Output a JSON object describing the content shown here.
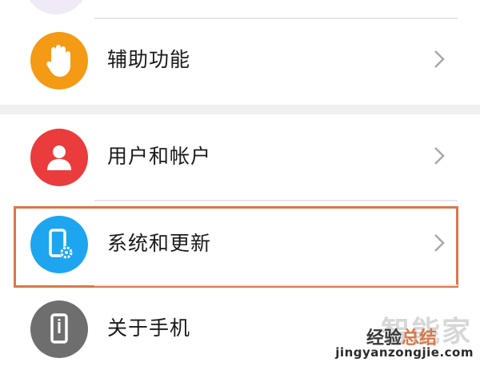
{
  "menu": {
    "items": [
      {
        "label": "辅助功能",
        "icon": "hand-icon",
        "color": "#f59a14"
      },
      {
        "label": "用户和帐户",
        "icon": "user-icon",
        "color": "#ea3c3c"
      },
      {
        "label": "系统和更新",
        "icon": "phone-gear-icon",
        "color": "#1ea5f0"
      },
      {
        "label": "关于手机",
        "icon": "phone-info-icon",
        "color": "#6e6e6e"
      }
    ]
  },
  "highlight_color": "#d9784a",
  "watermark": {
    "logo_text": "智能家",
    "site_name_prefix": "经验",
    "site_name_suffix": "总结",
    "url": "jingyanzongjie.com"
  }
}
